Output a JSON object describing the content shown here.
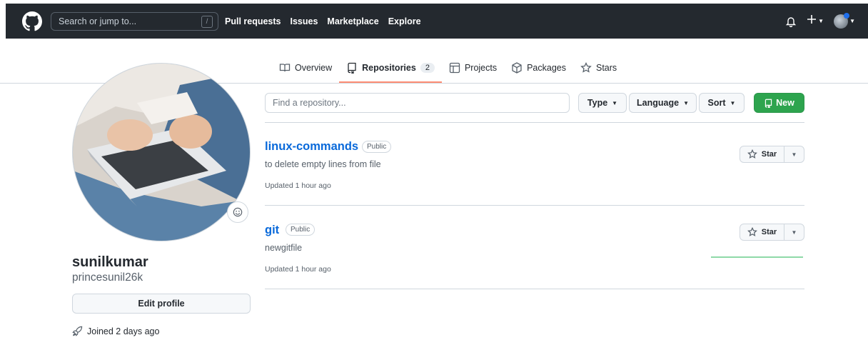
{
  "header": {
    "search_placeholder": "Search or jump to...",
    "search_shortcut": "/",
    "nav": [
      "Pull requests",
      "Issues",
      "Marketplace",
      "Explore"
    ],
    "icons": [
      "bell-icon",
      "plus-icon",
      "avatar"
    ]
  },
  "tabs": [
    {
      "label": "Overview",
      "icon": "book-icon"
    },
    {
      "label": "Repositories",
      "icon": "repo-icon",
      "count": "2",
      "active": true
    },
    {
      "label": "Projects",
      "icon": "project-icon"
    },
    {
      "label": "Packages",
      "icon": "package-icon"
    },
    {
      "label": "Stars",
      "icon": "star-icon"
    }
  ],
  "profile": {
    "name": "sunilkumar",
    "login": "princesunil26k",
    "edit_label": "Edit profile",
    "joined": "Joined 2 days ago"
  },
  "filters": {
    "find_placeholder": "Find a repository...",
    "type_label": "Type",
    "language_label": "Language",
    "sort_label": "Sort",
    "new_label": "New"
  },
  "repos": [
    {
      "name": "linux-commands",
      "visibility": "Public",
      "description": "to delete empty lines from file",
      "updated": "Updated 1 hour ago",
      "star_label": "Star"
    },
    {
      "name": "git",
      "visibility": "Public",
      "description": "newgitfile",
      "updated": "Updated 1 hour ago",
      "star_label": "Star"
    }
  ],
  "colors": {
    "header_bg": "#24292f",
    "link": "#0969da",
    "primary_button": "#2da44e",
    "active_tab_underline": "#fd8c73"
  }
}
